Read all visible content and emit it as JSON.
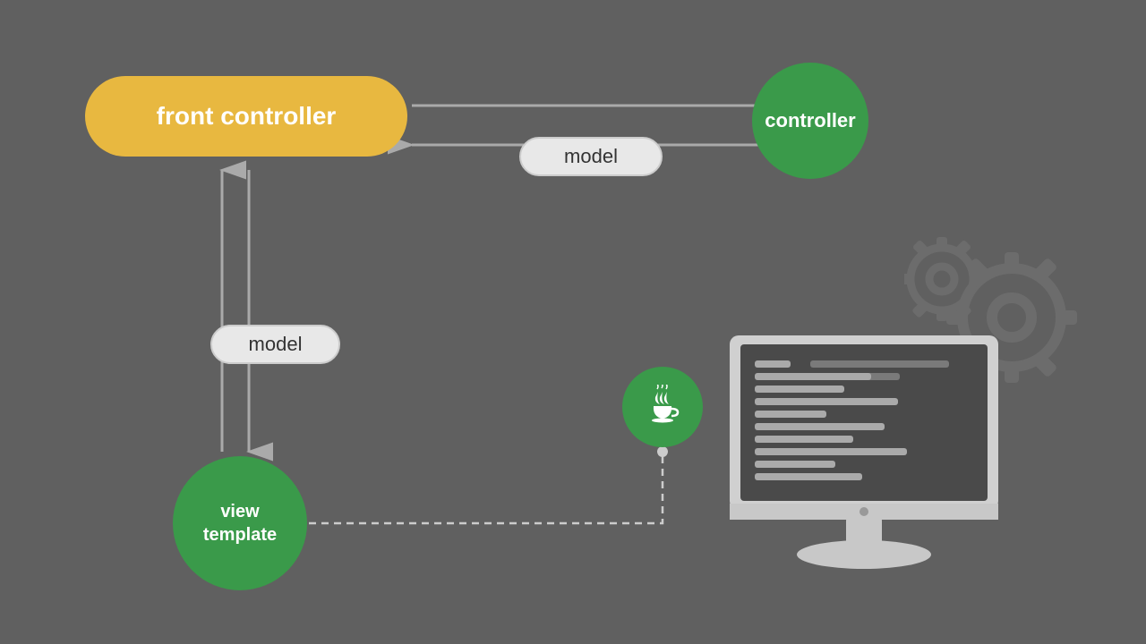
{
  "background_color": "#606060",
  "front_controller": {
    "label": "front controller",
    "bg_color": "#E8B840",
    "text_color": "#ffffff"
  },
  "controller": {
    "label": "controller",
    "bg_color": "#3A9A4A",
    "text_color": "#ffffff"
  },
  "model_horizontal": {
    "label": "model"
  },
  "model_vertical": {
    "label": "model"
  },
  "view_template": {
    "label": "view\ntemplate",
    "label_line1": "view",
    "label_line2": "template",
    "bg_color": "#3A9A4A"
  },
  "java_badge": {
    "bg_color": "#3A9A4A"
  },
  "arrows": {
    "color": "#aaaaaa"
  }
}
